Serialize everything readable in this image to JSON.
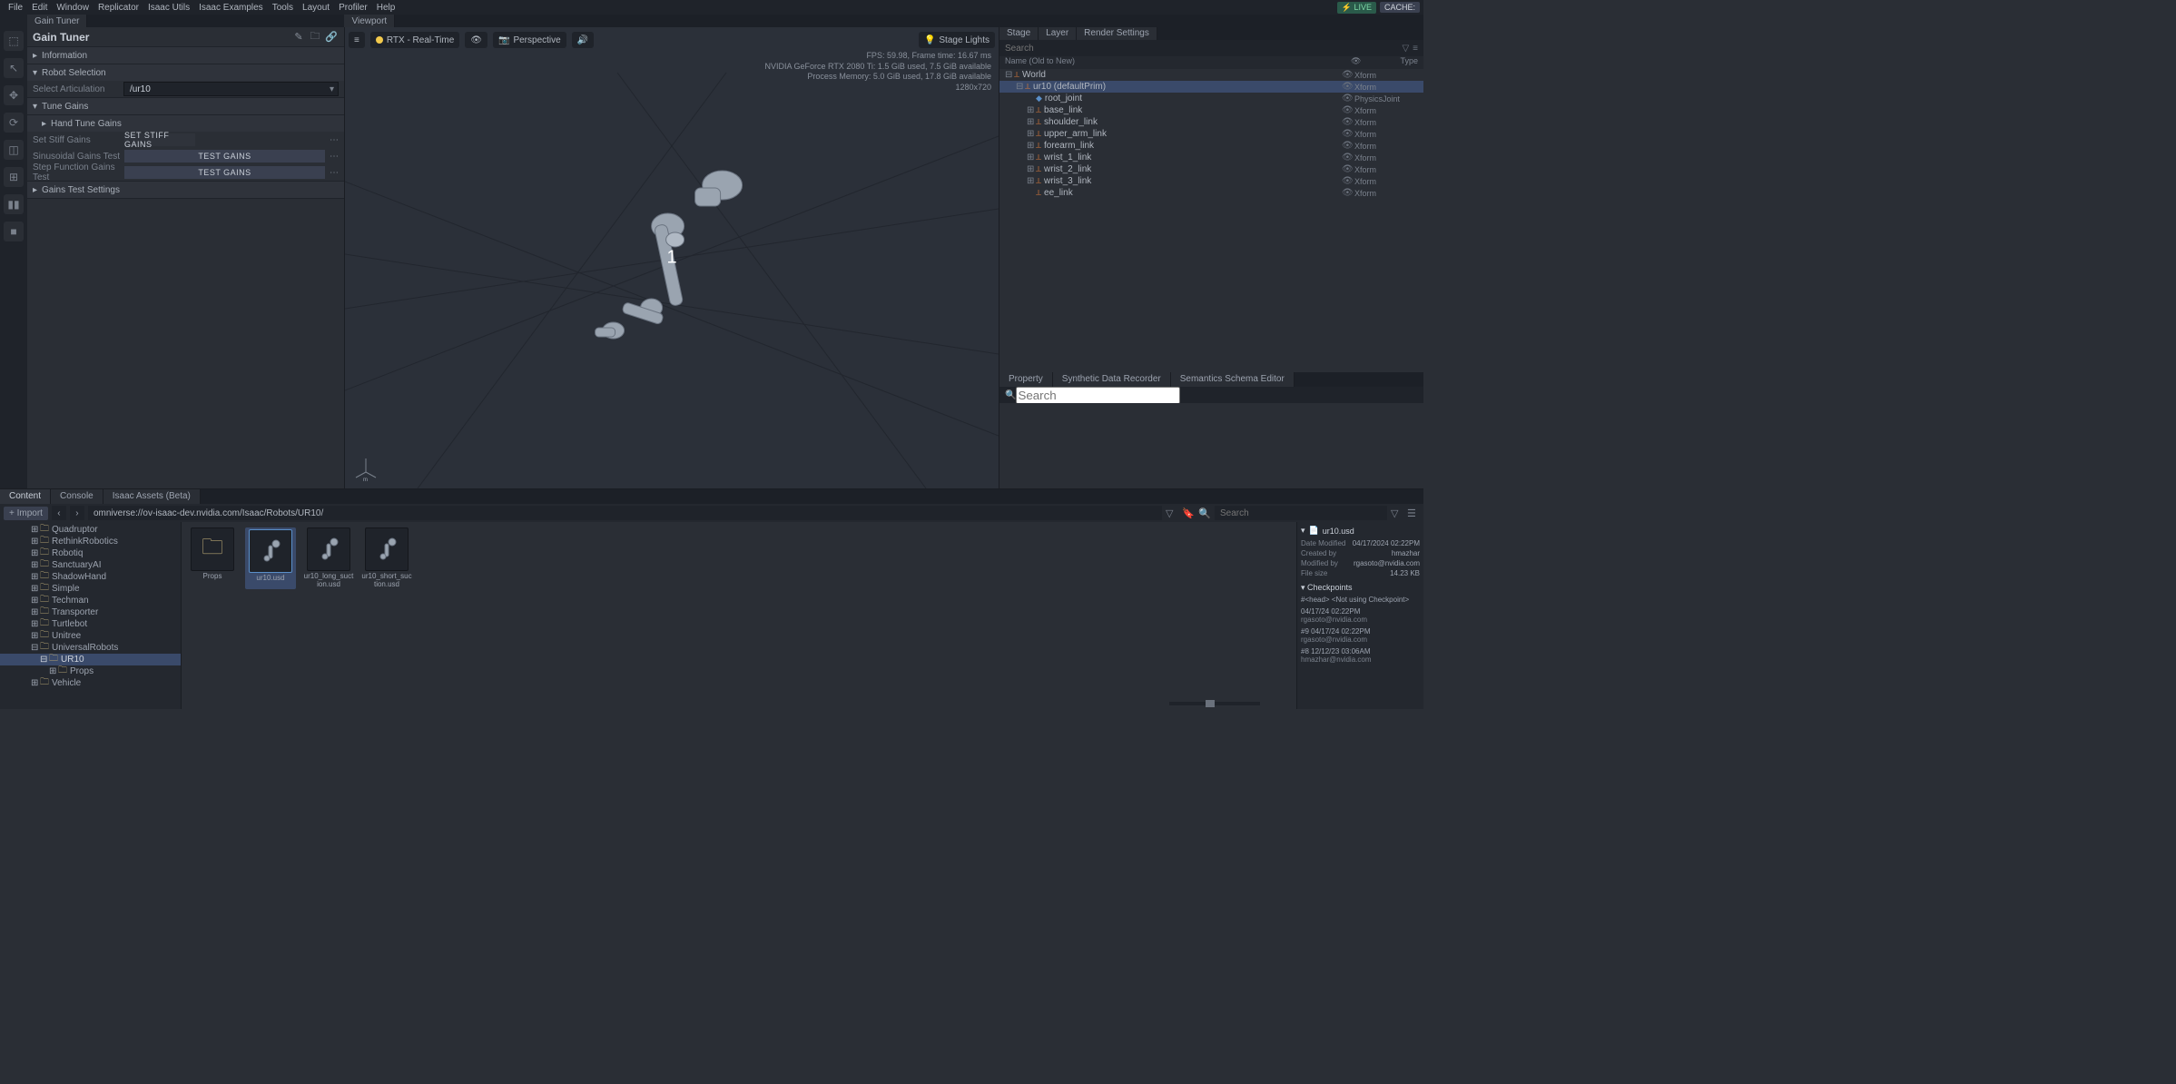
{
  "menu": [
    "File",
    "Edit",
    "Window",
    "Replicator",
    "Isaac Utils",
    "Isaac Examples",
    "Tools",
    "Layout",
    "Profiler",
    "Help"
  ],
  "status_badges": {
    "live": "LIVE",
    "cache": "CACHE:"
  },
  "left_tab": "Gain Tuner",
  "viewport_tab": "Viewport",
  "gain_tuner": {
    "title": "Gain Tuner",
    "sections": {
      "information": "Information",
      "robot_selection": "Robot Selection",
      "tune_gains": "Tune Gains",
      "hand_tune_gains": "Hand Tune Gains",
      "gains_test_settings": "Gains Test Settings"
    },
    "select_articulation_label": "Select Articulation",
    "select_articulation_value": "/ur10",
    "set_stiff_label": "Set Stiff Gains",
    "set_stiff_btn": "SET STIFF GAINS",
    "sin_label": "Sinusoidal Gains Test",
    "step_label": "Step Function Gains Test",
    "test_gains_btn": "TEST GAINS"
  },
  "viewport": {
    "render": "RTX - Real-Time",
    "camera": "Perspective",
    "lights": "Stage Lights",
    "stats": {
      "l1": "FPS: 59.98, Frame time: 16.67 ms",
      "l2": "NVIDIA GeForce RTX 2080 Ti: 1.5 GiB used, 7.5 GiB available",
      "l3": "Process Memory: 5.0 GiB used, 17.8 GiB available",
      "l4": "1280x720"
    },
    "overlay": "1",
    "unit": "m"
  },
  "stage": {
    "tabs": [
      "Stage",
      "Layer",
      "Render Settings"
    ],
    "search_placeholder": "Search",
    "col_name": "Name (Old to New)",
    "col_type": "Type",
    "rows": [
      {
        "depth": 0,
        "exp": "⊟",
        "icon": "x",
        "name": "World",
        "type": "Xform"
      },
      {
        "depth": 1,
        "exp": "⊟",
        "icon": "x",
        "name": "ur10 (defaultPrim)",
        "type": "Xform",
        "sel": true
      },
      {
        "depth": 2,
        "exp": "",
        "icon": "p",
        "name": "root_joint",
        "type": "PhysicsJoint"
      },
      {
        "depth": 2,
        "exp": "⊞",
        "icon": "x",
        "name": "base_link",
        "type": "Xform"
      },
      {
        "depth": 2,
        "exp": "⊞",
        "icon": "x",
        "name": "shoulder_link",
        "type": "Xform"
      },
      {
        "depth": 2,
        "exp": "⊞",
        "icon": "x",
        "name": "upper_arm_link",
        "type": "Xform"
      },
      {
        "depth": 2,
        "exp": "⊞",
        "icon": "x",
        "name": "forearm_link",
        "type": "Xform"
      },
      {
        "depth": 2,
        "exp": "⊞",
        "icon": "x",
        "name": "wrist_1_link",
        "type": "Xform"
      },
      {
        "depth": 2,
        "exp": "⊞",
        "icon": "x",
        "name": "wrist_2_link",
        "type": "Xform"
      },
      {
        "depth": 2,
        "exp": "⊞",
        "icon": "x",
        "name": "wrist_3_link",
        "type": "Xform"
      },
      {
        "depth": 2,
        "exp": "",
        "icon": "x",
        "name": "ee_link",
        "type": "Xform"
      }
    ]
  },
  "property": {
    "tabs": [
      "Property",
      "Synthetic Data Recorder",
      "Semantics Schema Editor"
    ],
    "search_placeholder": "Search"
  },
  "content": {
    "tabs": [
      "Content",
      "Console",
      "Isaac Assets (Beta)"
    ],
    "import": "+ Import",
    "path": "omniverse://ov-isaac-dev.nvidia.com/Isaac/Robots/UR10/",
    "search_placeholder": "Search",
    "tree": [
      {
        "depth": 3,
        "name": "Quadruptor"
      },
      {
        "depth": 3,
        "name": "RethinkRobotics"
      },
      {
        "depth": 3,
        "name": "Robotiq"
      },
      {
        "depth": 3,
        "name": "SanctuaryAI"
      },
      {
        "depth": 3,
        "name": "ShadowHand"
      },
      {
        "depth": 3,
        "name": "Simple"
      },
      {
        "depth": 3,
        "name": "Techman"
      },
      {
        "depth": 3,
        "name": "Transporter"
      },
      {
        "depth": 3,
        "name": "Turtlebot"
      },
      {
        "depth": 3,
        "name": "Unitree"
      },
      {
        "depth": 3,
        "name": "UniversalRobots",
        "exp": "⊟"
      },
      {
        "depth": 4,
        "name": "UR10",
        "sel": true,
        "exp": "⊟"
      },
      {
        "depth": 5,
        "name": "Props"
      },
      {
        "depth": 3,
        "name": "Vehicle"
      }
    ],
    "grid": [
      {
        "name": "Props",
        "folder": true
      },
      {
        "name": "ur10.usd",
        "sel": true
      },
      {
        "name": "ur10_long_suction.usd"
      },
      {
        "name": "ur10_short_suction.usd"
      }
    ],
    "detail": {
      "file": "ur10.usd",
      "date_modified_k": "Date Modified",
      "date_modified_v": "04/17/2024 02:22PM",
      "created_k": "Created by",
      "created_v": "hmazhar",
      "modified_k": "Modified by",
      "modified_v": "rgasoto@nvidia.com",
      "size_k": "File size",
      "size_v": "14.23 KB",
      "checkpoints": "Checkpoints",
      "head": "#<head>   <Not using Checkpoint>",
      "cps": [
        {
          "l1": "04/17/24 02:22PM",
          "l2": "rgasoto@nvidia.com"
        },
        {
          "l1": "#9   04/17/24 02:22PM",
          "l2": "rgasoto@nvidia.com"
        },
        {
          "l1": "#8   12/12/23 03:06AM",
          "l2": "hmazhar@nvidia.com"
        }
      ]
    }
  }
}
